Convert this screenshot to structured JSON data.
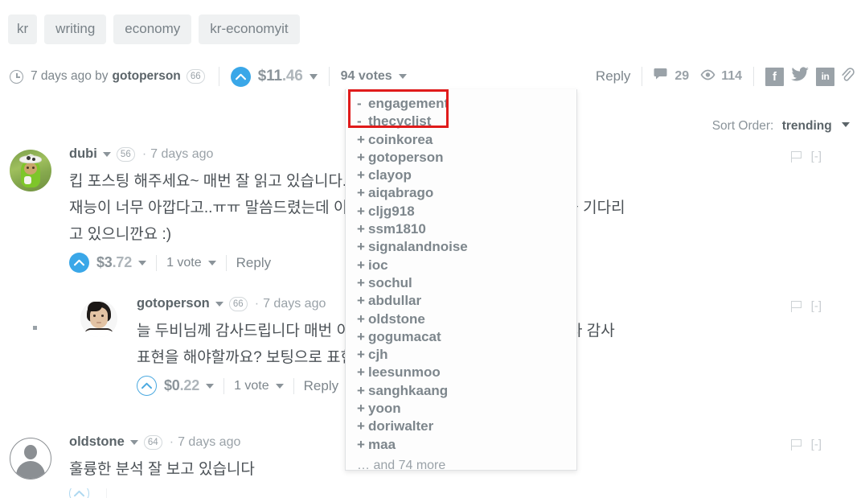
{
  "tags": [
    "kr",
    "writing",
    "economy",
    "kr-economyit"
  ],
  "post_meta": {
    "clock_icon": "clock-icon",
    "time_text": "7 days ago by",
    "author": "gotoperson",
    "author_reputation": "66",
    "upvote_icon": "upvote-arrow-icon",
    "payout_dollars": "$11",
    "payout_cents": ".46",
    "payout_caret_icon": "chevron-down-icon",
    "votes_label": "94 votes",
    "votes_caret_icon": "chevron-down-icon",
    "reply_label": "Reply",
    "comment_icon": "comment-bubble-icon",
    "comment_count": "29",
    "views_icon": "eye-icon",
    "views_count": "114",
    "share_facebook": "f",
    "share_twitter": "twitter-bird-icon",
    "share_linkedin": "in",
    "share_link": "link-chain-icon"
  },
  "sort": {
    "label": "Sort Order:",
    "value": "trending",
    "caret_icon": "chevron-down-icon"
  },
  "voter_dropdown": {
    "voters": [
      {
        "sign": "-",
        "name": "engagement"
      },
      {
        "sign": "-",
        "name": "thecyclist"
      },
      {
        "sign": "+",
        "name": "coinkorea"
      },
      {
        "sign": "+",
        "name": "gotoperson"
      },
      {
        "sign": "+",
        "name": "clayop"
      },
      {
        "sign": "+",
        "name": "aiqabrago"
      },
      {
        "sign": "+",
        "name": "cljg918"
      },
      {
        "sign": "+",
        "name": "ssm1810"
      },
      {
        "sign": "+",
        "name": "signalandnoise"
      },
      {
        "sign": "+",
        "name": "ioc"
      },
      {
        "sign": "+",
        "name": "sochul"
      },
      {
        "sign": "+",
        "name": "abdullar"
      },
      {
        "sign": "+",
        "name": "oldstone"
      },
      {
        "sign": "+",
        "name": "gogumacat"
      },
      {
        "sign": "+",
        "name": "cjh"
      },
      {
        "sign": "+",
        "name": "leesunmoo"
      },
      {
        "sign": "+",
        "name": "sanghkaang"
      },
      {
        "sign": "+",
        "name": "yoon"
      },
      {
        "sign": "+",
        "name": "doriwalter"
      },
      {
        "sign": "+",
        "name": "maa"
      }
    ],
    "more_text": "… and 74 more",
    "highlight_color": "#e01b1b"
  },
  "comments": [
    {
      "avatar_name": "avatar-dubi",
      "author": "dubi",
      "caret_icon": "chevron-down-icon",
      "reputation": "56",
      "separator": "·",
      "timestamp": "7 days ago",
      "text_lines": [
        "킵 포스팅 해주세요~ 매번 잘 읽고 있습니다. 스팀 한번 해보시는게 어떠시냐고",
        "재능이 너무 아깝다고..ㅠㅠ 말씀드렸는데 이렇게 많은 분들이 @gotoperson님을 기다리",
        "고 있으니깐요 :)"
      ],
      "payout_dollars": "$3",
      "payout_cents": ".72",
      "votes_label": "1 vote",
      "reply_label": "Reply",
      "flag_icon": "flag-icon",
      "collapse_label": "[-]"
    },
    {
      "avatar_name": "avatar-gotoperson",
      "author": "gotoperson",
      "caret_icon": "chevron-down-icon",
      "reputation": "66",
      "separator": "·",
      "timestamp": "7 days ago",
      "text_lines": [
        "늘 두비님께 감사드립니다 매번 이렇게 제 글을 정독까지 해주시니 뭐라 감사",
        "표현을 해야할까요? 보팅으로 표현합니다."
      ],
      "payout_dollars": "$0",
      "payout_cents": ".22",
      "votes_label": "1 vote",
      "reply_label": "Reply",
      "flag_icon": "flag-icon",
      "collapse_label": "[-]"
    },
    {
      "avatar_name": "avatar-oldstone",
      "author": "oldstone",
      "caret_icon": "chevron-down-icon",
      "reputation": "64",
      "separator": "·",
      "timestamp": "7 days ago",
      "text_lines": [
        "훌륭한 분석 잘 보고 있습니다"
      ],
      "flag_icon": "flag-icon",
      "collapse_label": "[-]"
    }
  ],
  "colors": {
    "accent_blue": "#3aa7e8",
    "tag_bg": "#eff1f2",
    "text_primary": "#4b5156",
    "text_muted": "#9aa2a8",
    "mention": "#4a6fa5"
  }
}
